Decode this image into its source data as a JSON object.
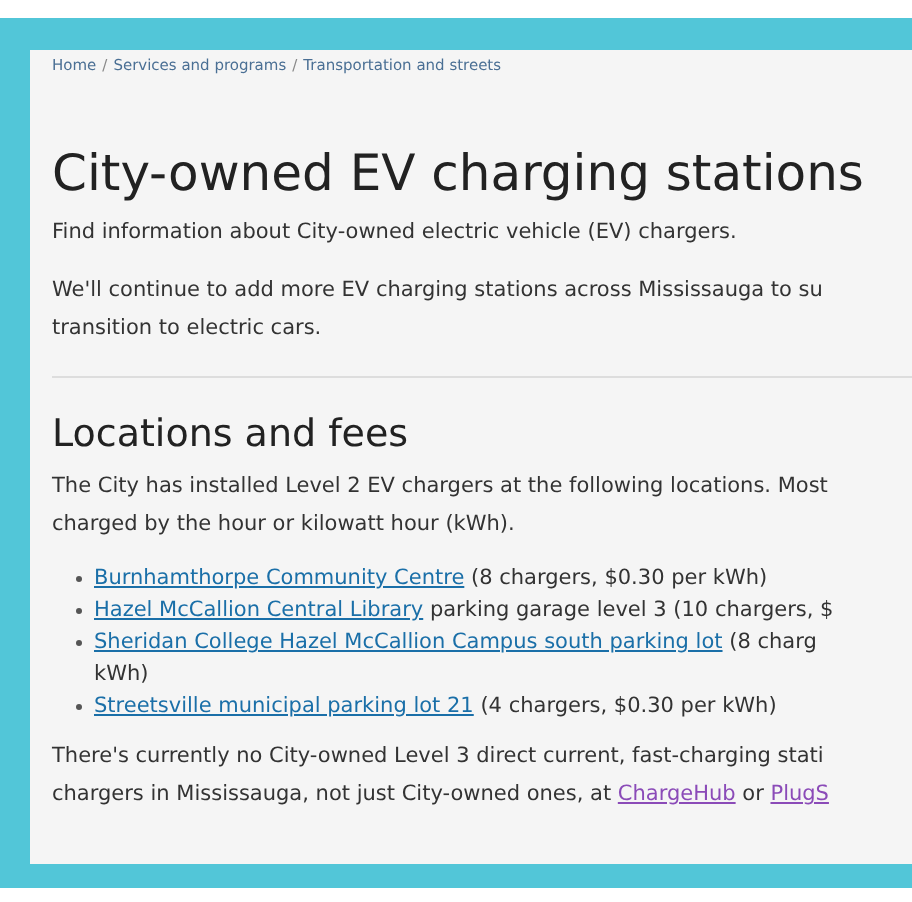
{
  "breadcrumb": [
    {
      "kind": "link",
      "text": "Home"
    },
    {
      "kind": "separator",
      "text": "/"
    },
    {
      "kind": "link",
      "text": "Services and programs"
    },
    {
      "kind": "separator",
      "text": "/"
    },
    {
      "kind": "link",
      "text": "Transportation and streets"
    }
  ],
  "title": "City-owned EV charging stations",
  "intro": "Find information about City-owned electric vehicle (EV) chargers.",
  "paragraph": "We'll continue to add more EV charging stations across Mississauga to su\ntransition to electric cars.",
  "section": {
    "heading": "Locations and fees",
    "paragraph": "The City has installed Level 2 EV chargers at the following locations. Most\ncharged by the hour or kilowatt hour (kWh).",
    "locations": [
      {
        "link": "Burnhamthorpe Community Centre",
        "details": " (8 chargers, $0.30 per kWh)"
      },
      {
        "link": "Hazel McCallion Central Library",
        "details": " parking garage level 3 (10 chargers, $"
      },
      {
        "link": "Sheridan College Hazel McCallion Campus south parking lot",
        "details": " (8 charg\nkWh)"
      },
      {
        "link": "Streetsville municipal parking lot 21",
        "details": " (4 chargers, $0.30 per kWh)"
      }
    ],
    "note": [
      {
        "kind": "text",
        "text": "There's currently no City-owned Level 3 direct current, fast-charging stati\nchargers in Mississauga, not just City-owned ones, at "
      },
      {
        "kind": "link",
        "text": "ChargeHub"
      },
      {
        "kind": "text",
        "text": " or "
      },
      {
        "kind": "link",
        "text": "PlugS"
      }
    ]
  }
}
